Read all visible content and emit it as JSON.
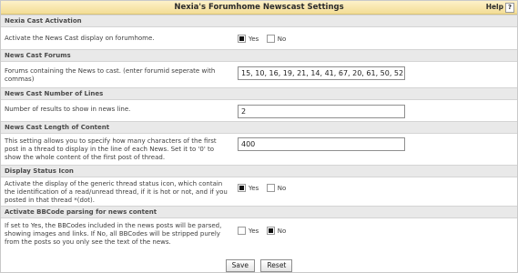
{
  "header": {
    "title": "Nexia's Forumhome Newscast Settings",
    "help_label": "Help",
    "help_icon": "?"
  },
  "settings": [
    {
      "section": "Nexia Cast Activation",
      "description": "Activate the News Cast display on forumhome.",
      "control": "radio",
      "yes_label": "Yes",
      "no_label": "No",
      "selected": "Yes"
    },
    {
      "section": "News Cast Forums",
      "description": "Forums containing the News to cast. (enter forumid seperate with commas)",
      "control": "text",
      "value": "15, 10, 16, 19, 21, 14, 41, 67, 20, 61, 50, 52"
    },
    {
      "section": "News Cast Number of Lines",
      "description": "Number of results to show in news line.",
      "control": "text",
      "value": "2"
    },
    {
      "section": "News Cast Length of Content",
      "description": "This setting allows you to specify how many characters of the first post in a thread to display in the line of each News. Set it to '0' to show the whole content of the first post of thread.",
      "control": "text",
      "value": "400"
    },
    {
      "section": "Display Status Icon",
      "description": "Activate the display of the generic thread status icon, which contain the identification of a read/unread thread, if it is hot or not, and if you posted in that thread *(dot).",
      "control": "radio",
      "yes_label": "Yes",
      "no_label": "No",
      "selected": "Yes"
    },
    {
      "section": "Activate BBCode parsing for news content",
      "description": "If set to Yes, the BBCodes included in the news posts will be parsed, showing images and links. If No, all BBCodes will be stripped purely from the posts so you only see the text of the news.",
      "control": "radio",
      "yes_label": "Yes",
      "no_label": "No",
      "selected": "No"
    }
  ],
  "buttons": {
    "save_label": "Save",
    "reset_label": "Reset"
  }
}
